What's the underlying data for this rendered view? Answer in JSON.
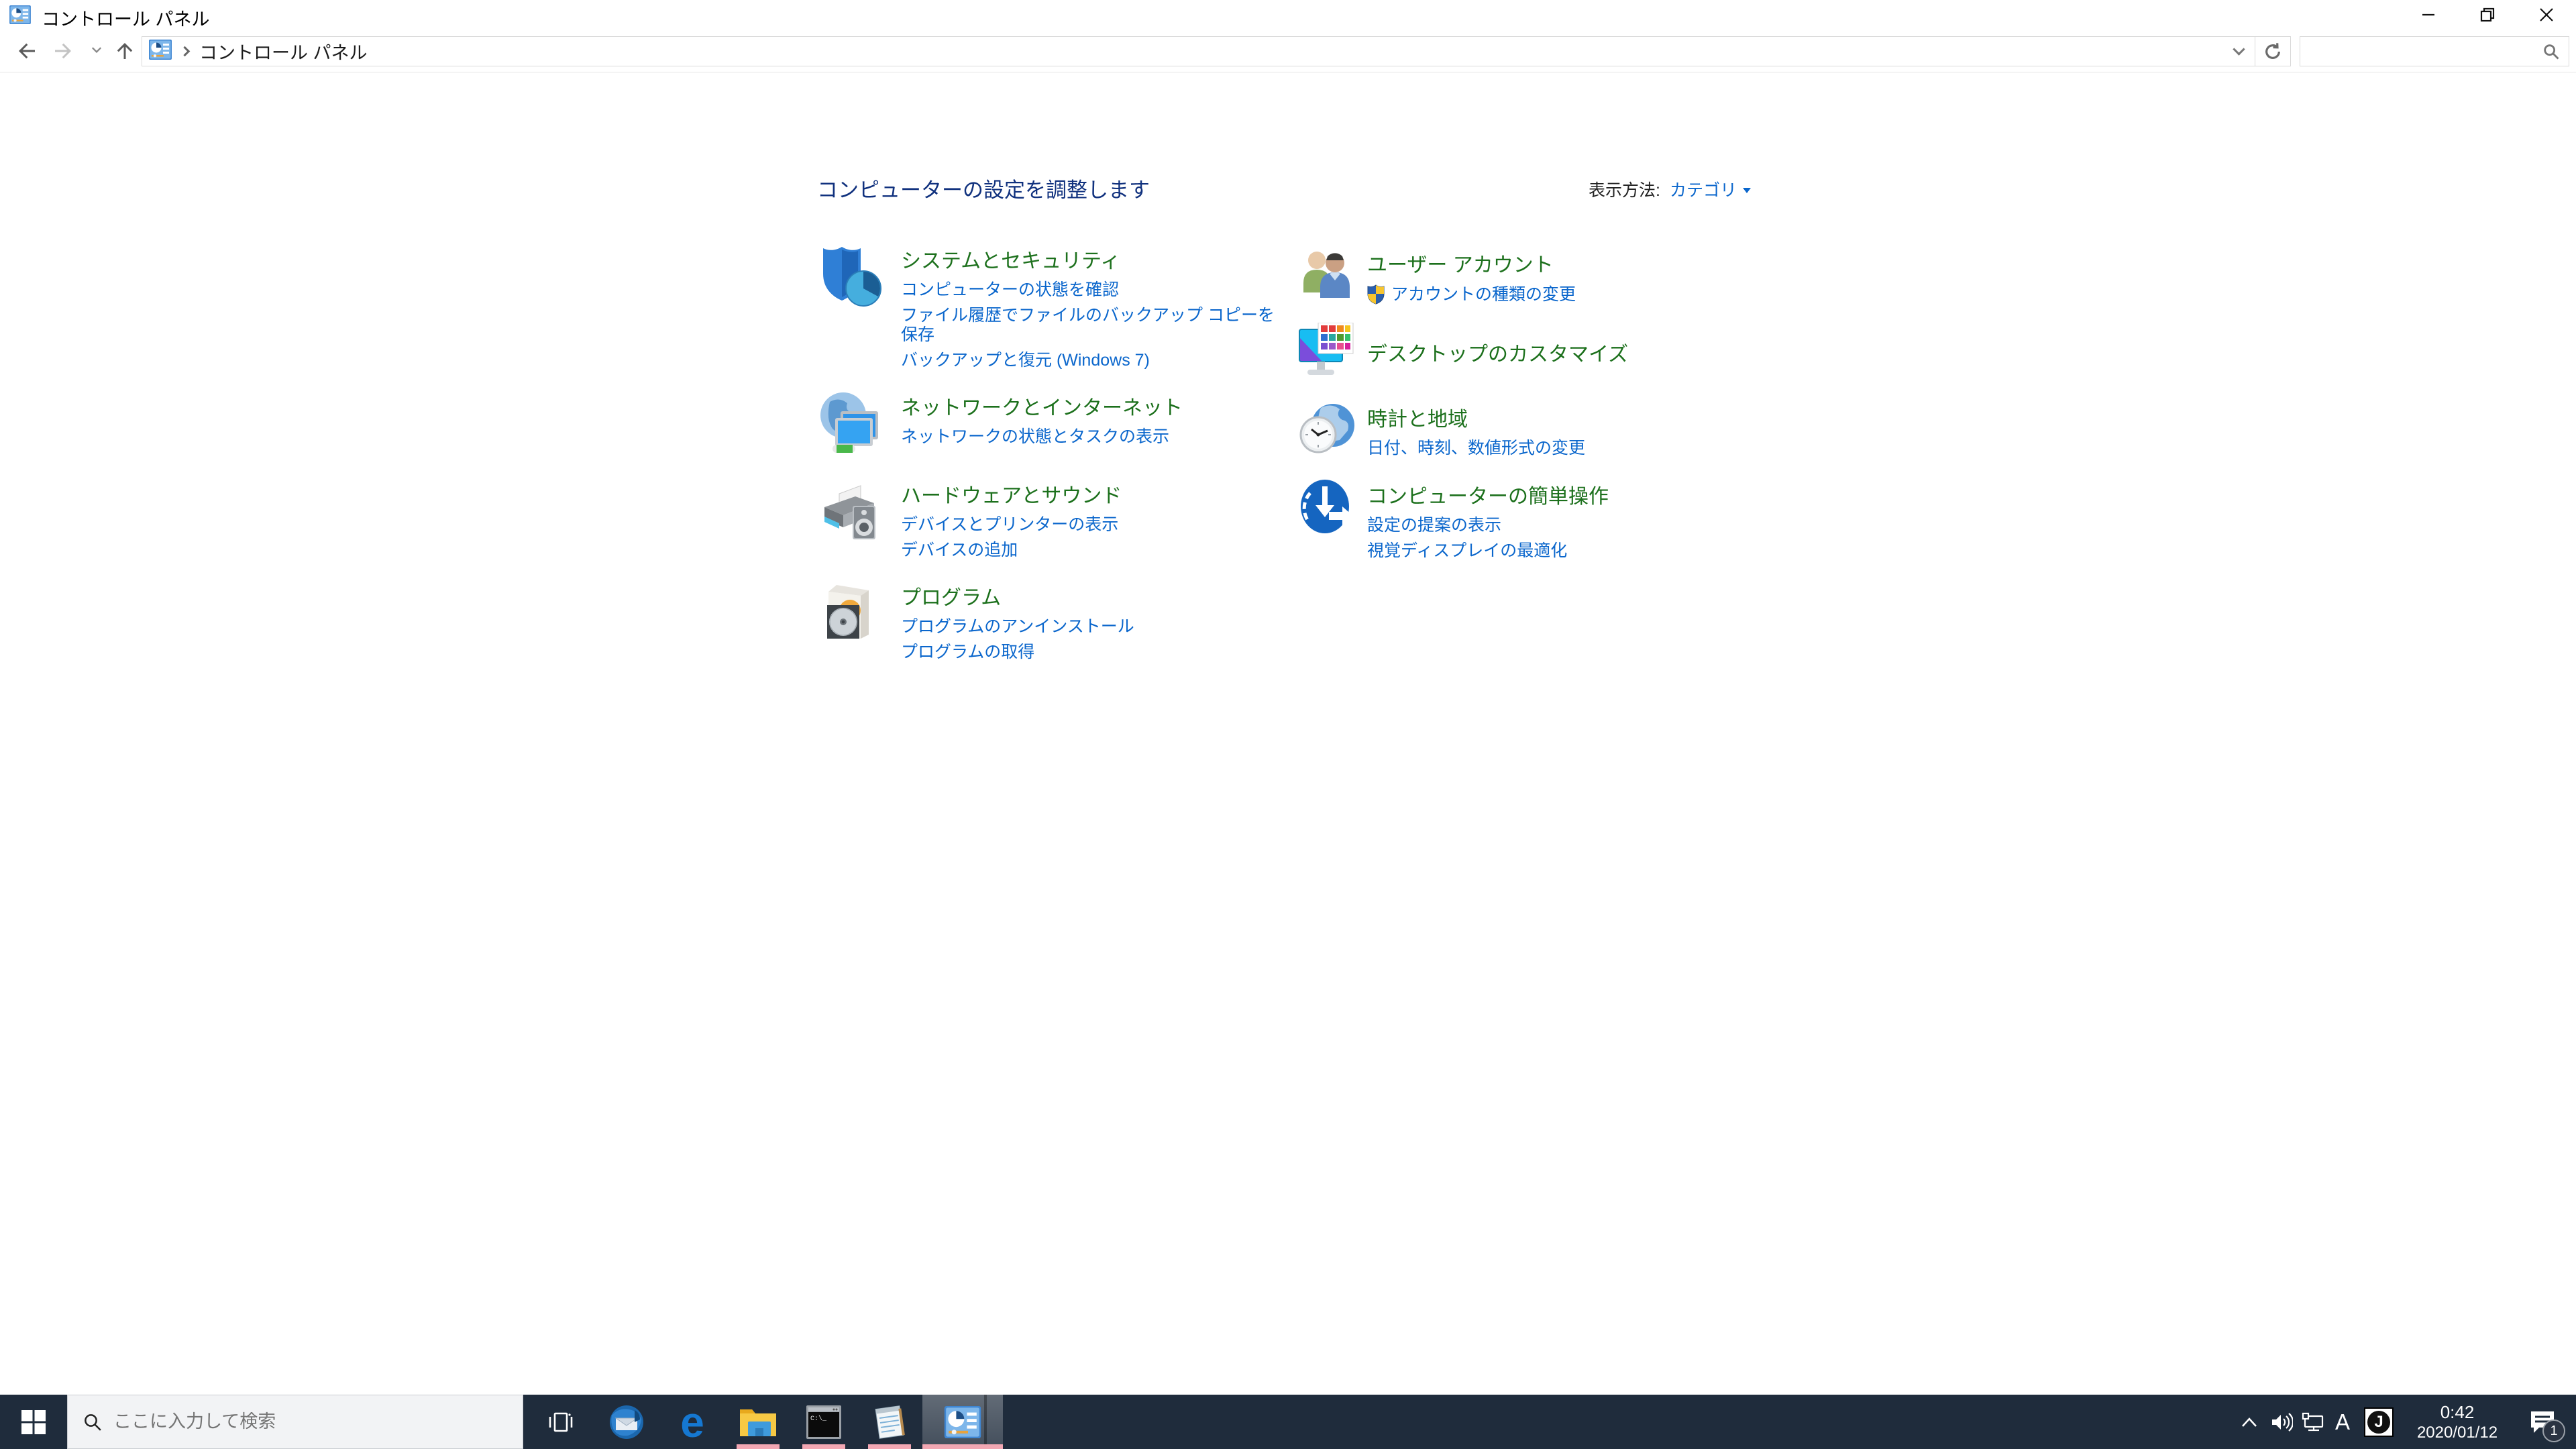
{
  "window": {
    "title": "コントロール パネル"
  },
  "navbar": {
    "breadcrumb_root": "コントロール パネル",
    "explorer_search_value": ""
  },
  "main": {
    "heading": "コンピューターの設定を調整します",
    "view_by_label": "表示方法:",
    "view_by_value": "カテゴリ",
    "categories": [
      {
        "title": "システムとセキュリティ",
        "links": [
          "コンピューターの状態を確認",
          "ファイル履歴でファイルのバックアップ コピーを保存",
          "バックアップと復元 (Windows 7)"
        ]
      },
      {
        "title": "ネットワークとインターネット",
        "links": [
          "ネットワークの状態とタスクの表示"
        ]
      },
      {
        "title": "ハードウェアとサウンド",
        "links": [
          "デバイスとプリンターの表示",
          "デバイスの追加"
        ]
      },
      {
        "title": "プログラム",
        "links": [
          "プログラムのアンインストール",
          "プログラムの取得"
        ]
      },
      {
        "title": "ユーザー アカウント",
        "links": [
          "アカウントの種類の変更"
        ]
      },
      {
        "title": "デスクトップのカスタマイズ",
        "links": []
      },
      {
        "title": "時計と地域",
        "links": [
          "日付、時刻、数値形式の変更"
        ]
      },
      {
        "title": "コンピューターの簡単操作",
        "links": [
          "設定の提案の表示",
          "視覚ディスプレイの最適化"
        ]
      }
    ]
  },
  "taskbar": {
    "search_placeholder": "ここに入力して検索",
    "cmd_glyph": "C:\\_",
    "edge_glyph": "e",
    "ime_mode": "A",
    "ime_badge": "J",
    "clock_time": "0:42",
    "clock_date": "2020/01/12",
    "notification_count": "1"
  },
  "colors": {
    "category_title_green": "#1c701c",
    "task_link_blue": "#0a66cc",
    "heading_navy": "#10317e",
    "taskbar_bg": "#1f2c3c",
    "running_indicator_pink": "#f2a7b3"
  }
}
